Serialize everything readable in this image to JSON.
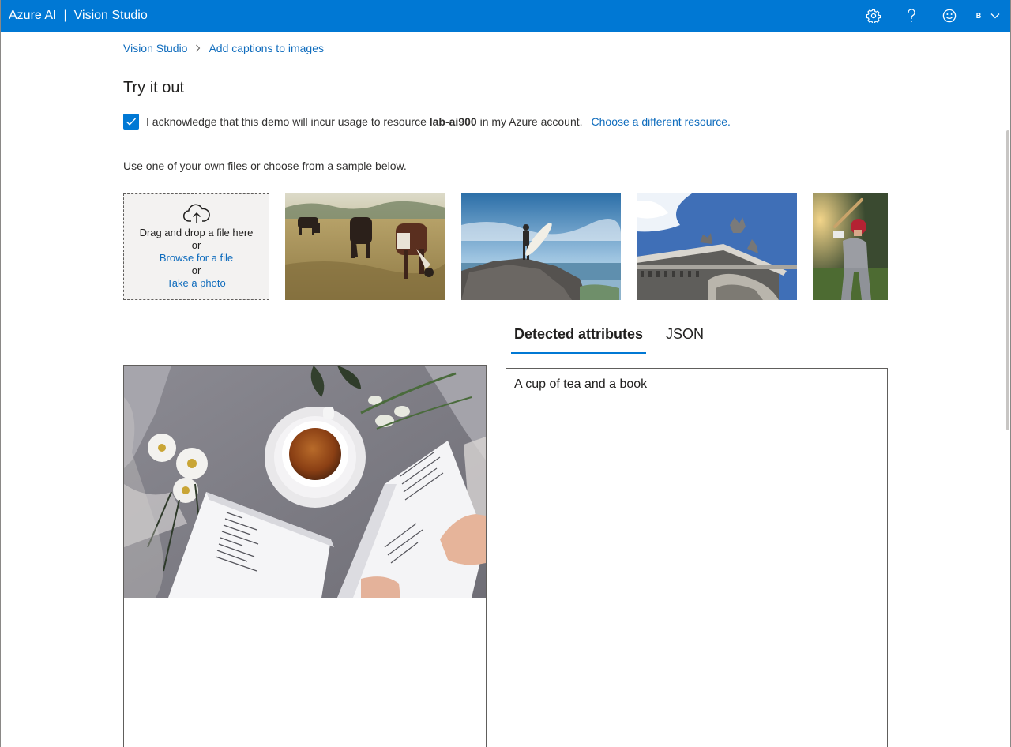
{
  "header": {
    "brand": "Azure AI",
    "separator": "|",
    "product": "Vision Studio",
    "user_initial": "B",
    "icons": [
      "gear-icon",
      "help-icon",
      "smiley-icon",
      "chevron-down-icon"
    ],
    "accent_color": "#0078d4"
  },
  "breadcrumb": {
    "root": "Vision Studio",
    "current": "Add captions to images"
  },
  "page": {
    "title": "Try it out"
  },
  "acknowledge": {
    "checked": true,
    "text_before": "I acknowledge that this demo will incur usage to resource",
    "resource": "lab-ai900",
    "text_after": "in my Azure account.",
    "link": "Choose a different resource."
  },
  "samples": {
    "hint": "Use one of your own files or choose from a sample below.",
    "upload": {
      "drag_text": "Drag and drop a file here",
      "or1": "or",
      "browse": "Browse for a file",
      "or2": "or",
      "photo": "Take a photo"
    },
    "images": [
      "cows-in-field",
      "surfer-on-rock",
      "building-statues",
      "baseball-batter"
    ]
  },
  "tabs": [
    {
      "label": "Detected attributes",
      "active": true
    },
    {
      "label": "JSON",
      "active": false
    }
  ],
  "result": {
    "image": "tea-cup-and-book",
    "caption": "A cup of tea and a book"
  }
}
